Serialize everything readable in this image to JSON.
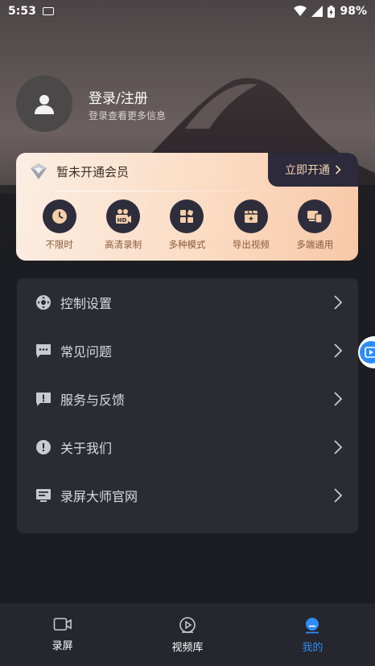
{
  "status_bar": {
    "time": "5:53",
    "battery": "98%"
  },
  "profile": {
    "title": "登录/注册",
    "subtitle": "登录查看更多信息"
  },
  "vip": {
    "title": "暂未开通会员",
    "button": "立即开通",
    "features": [
      {
        "label": "不限时",
        "icon": "clock-icon"
      },
      {
        "label": "高清录制",
        "icon": "hd-camera-icon"
      },
      {
        "label": "多种模式",
        "icon": "modes-icon"
      },
      {
        "label": "导出视频",
        "icon": "export-video-icon"
      },
      {
        "label": "多端通用",
        "icon": "multi-device-icon"
      }
    ]
  },
  "menu": [
    {
      "label": "控制设置",
      "icon": "control-settings-icon"
    },
    {
      "label": "常见问题",
      "icon": "faq-icon"
    },
    {
      "label": "服务与反馈",
      "icon": "feedback-icon"
    },
    {
      "label": "关于我们",
      "icon": "info-icon"
    },
    {
      "label": "录屏大师官网",
      "icon": "website-icon"
    }
  ],
  "tabs": [
    {
      "label": "录屏",
      "icon": "record-camera-icon",
      "active": false
    },
    {
      "label": "视频库",
      "icon": "video-library-icon",
      "active": false
    },
    {
      "label": "我的",
      "icon": "profile-icon",
      "active": true
    }
  ],
  "colors": {
    "accent": "#2f8cf5",
    "vip_gold": "#f5d3b6",
    "background": "#1c1d22"
  }
}
